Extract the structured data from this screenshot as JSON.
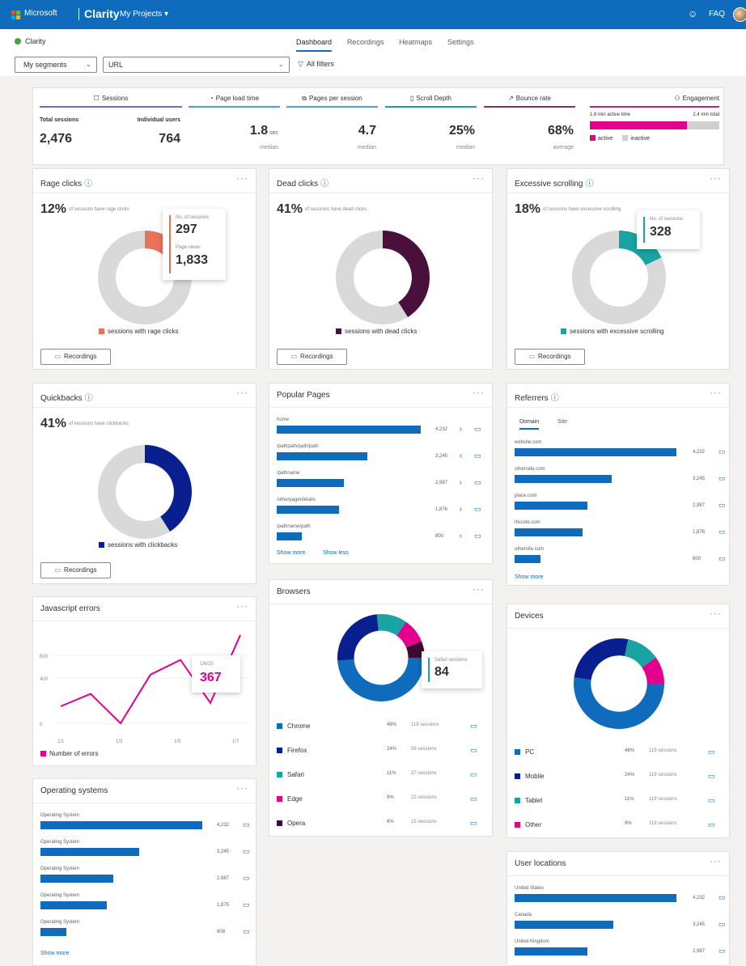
{
  "topbar": {
    "brand": "Microsoft",
    "product": "Clarity",
    "projects": "My Projects ▾",
    "help": "☺",
    "faq": "FAQ",
    "color": "#0f6cbd"
  },
  "subbar": {
    "project": "Clarity",
    "tabs": [
      "Dashboard",
      "Recordings",
      "Heatmaps",
      "Settings"
    ],
    "active_tab": "Dashboard"
  },
  "filters": {
    "segments": "My segments",
    "segments_chev": "⌄",
    "url": "URL",
    "url_chev": "⌄",
    "all_filters": "All filters",
    "filter_icon": "▽"
  },
  "summary": {
    "sessions_title": "Sessions",
    "total_label": "Total sessions",
    "total_value": "2,476",
    "individual_label": "Individual users",
    "individual_value": "764",
    "page_load": {
      "title": "Page load time",
      "value": "1.8",
      "unit": "sec",
      "sub": "median"
    },
    "pages_per_session": {
      "title": "Pages per session",
      "value": "4.7",
      "sub": "median"
    },
    "scroll_depth": {
      "title": "Scroll Depth",
      "value": "25%",
      "sub": "median"
    },
    "bounce_rate": {
      "title": "Bounce rate",
      "value": "68%",
      "sub": "average"
    },
    "engagement": {
      "title": "Engagement",
      "active_time": "1.8 min active time",
      "total_time": "2.4 min total",
      "active_fraction": 0.75,
      "legend_active": "active",
      "legend_inactive": "inactive"
    }
  },
  "rage_clicks": {
    "title": "Rage clicks",
    "pct": "12%",
    "desc": "of sessions have rage clicks",
    "fraction": 0.12,
    "tip_sessions_label": "No. of sessions",
    "tip_sessions": "297",
    "tip_pv_label": "Page views",
    "tip_pv": "1,833",
    "legend": "sessions with rage clicks",
    "color": "#e8735a",
    "button": "Recordings"
  },
  "dead_clicks": {
    "title": "Dead clicks",
    "pct": "41%",
    "desc": "of sessions have dead clicks",
    "fraction": 0.41,
    "legend": "sessions with dead clicks",
    "color": "#4b0f3c",
    "button": "Recordings"
  },
  "excessive_scrolling": {
    "title": "Excessive scrolling",
    "pct": "18%",
    "desc": "of sessions have excessive scrolling",
    "fraction": 0.18,
    "tip_label": "No. of sessions",
    "tip_value": "328",
    "legend": "sessions with excessive scrolling",
    "color": "#1aa3a3",
    "button": "Recordings"
  },
  "quickbacks": {
    "title": "Quickbacks",
    "pct": "41%",
    "desc": "of sessions have clickbacks",
    "fraction": 0.41,
    "legend": "sessions with clickbacks",
    "color": "#0a1f8f",
    "button": "Recordings"
  },
  "popular_pages": {
    "title": "Popular Pages",
    "rows": [
      {
        "label": "home",
        "value": "4,232",
        "fraction": 0.99
      },
      {
        "label": "/pathpath/path/path",
        "value": "3,245",
        "fraction": 0.62
      },
      {
        "label": "/pathname",
        "value": "2,987",
        "fraction": 0.46
      },
      {
        "label": "/otherpage/details",
        "value": "1,876",
        "fraction": 0.43
      },
      {
        "label": "/pathname/path",
        "value": "800",
        "fraction": 0.17
      }
    ],
    "show_more": "Show more",
    "show_less": "Show less"
  },
  "referrers": {
    "title": "Referrers",
    "tabs": [
      "Domain",
      "Site"
    ],
    "rows": [
      {
        "label": "website.com",
        "value": "4,232",
        "fraction": 1.0
      },
      {
        "label": "otherside.com",
        "value": "3,245",
        "fraction": 0.6
      },
      {
        "label": "place.com",
        "value": "2,987",
        "fraction": 0.45
      },
      {
        "label": "thissite.com",
        "value": "1,876",
        "fraction": 0.42
      },
      {
        "label": "othersite.com",
        "value": "800",
        "fraction": 0.16
      }
    ],
    "show_more": "Show more"
  },
  "browsers": {
    "title": "Browsers",
    "tip_label": "Safari sessions",
    "tip_value": "84",
    "items": [
      {
        "name": "Chrome",
        "pct": "48%",
        "sessions": "119 sessions",
        "color": "#0f6cbd",
        "fraction": 0.48
      },
      {
        "name": "Firefox",
        "pct": "24%",
        "sessions": "58 sessions",
        "color": "#0a1f8f",
        "fraction": 0.24
      },
      {
        "name": "Safari",
        "pct": "11%",
        "sessions": "27 sessions",
        "color": "#1aa3a3",
        "fraction": 0.11
      },
      {
        "name": "Edge",
        "pct": "9%",
        "sessions": "22 sessions",
        "color": "#e3008c",
        "fraction": 0.09
      },
      {
        "name": "Opera",
        "pct": "6%",
        "sessions": "15 sessions",
        "color": "#3b0a35",
        "fraction": 0.06
      }
    ]
  },
  "devices": {
    "title": "Devices",
    "items": [
      {
        "name": "PC",
        "pct": "48%",
        "sessions": "119 sessions",
        "color": "#0f6cbd",
        "fraction": 0.48
      },
      {
        "name": "Mobile",
        "pct": "24%",
        "sessions": "119 sessions",
        "color": "#0a1f8f",
        "fraction": 0.24
      },
      {
        "name": "Tablet",
        "pct": "11%",
        "sessions": "119 sessions",
        "color": "#1aa3a3",
        "fraction": 0.11
      },
      {
        "name": "Other",
        "pct": "9%",
        "sessions": "119 sessions",
        "color": "#e3008c",
        "fraction": 0.09
      }
    ]
  },
  "js_errors": {
    "title": "Javascript errors",
    "y_ticks": [
      "600",
      "400",
      "0"
    ],
    "x_ticks": [
      "1/1",
      "1/3",
      "1/5",
      "1/7"
    ],
    "tip_label": "1/6/20",
    "tip_value": "367",
    "legend": "Number of errors",
    "color": "#e3008c"
  },
  "os": {
    "title": "Operating systems",
    "rows": [
      {
        "label": "Operating System",
        "value": "4,232",
        "fraction": 1.0
      },
      {
        "label": "Operating System",
        "value": "3,245",
        "fraction": 0.61
      },
      {
        "label": "Operating System",
        "value": "2,987",
        "fraction": 0.45
      },
      {
        "label": "Operating System",
        "value": "1,875",
        "fraction": 0.41
      },
      {
        "label": "Operating System",
        "value": "808",
        "fraction": 0.16
      }
    ],
    "show_more": "Show more"
  },
  "user_locations": {
    "title": "User locations",
    "rows": [
      {
        "label": "United States",
        "value": "4,232",
        "fraction": 1.0
      },
      {
        "label": "Canada",
        "value": "3,245",
        "fraction": 0.61
      },
      {
        "label": "United Kingdom",
        "value": "2,987",
        "fraction": 0.45
      }
    ]
  },
  "chart_data": {
    "type": "line",
    "title": "Javascript errors",
    "x": [
      "1/1",
      "1/2",
      "1/3",
      "1/4",
      "1/5",
      "1/6",
      "1/7"
    ],
    "series": [
      {
        "name": "Number of errors",
        "values": [
          150,
          260,
          0,
          430,
          560,
          180,
          780
        ]
      }
    ],
    "ylim": [
      0,
      800
    ]
  }
}
